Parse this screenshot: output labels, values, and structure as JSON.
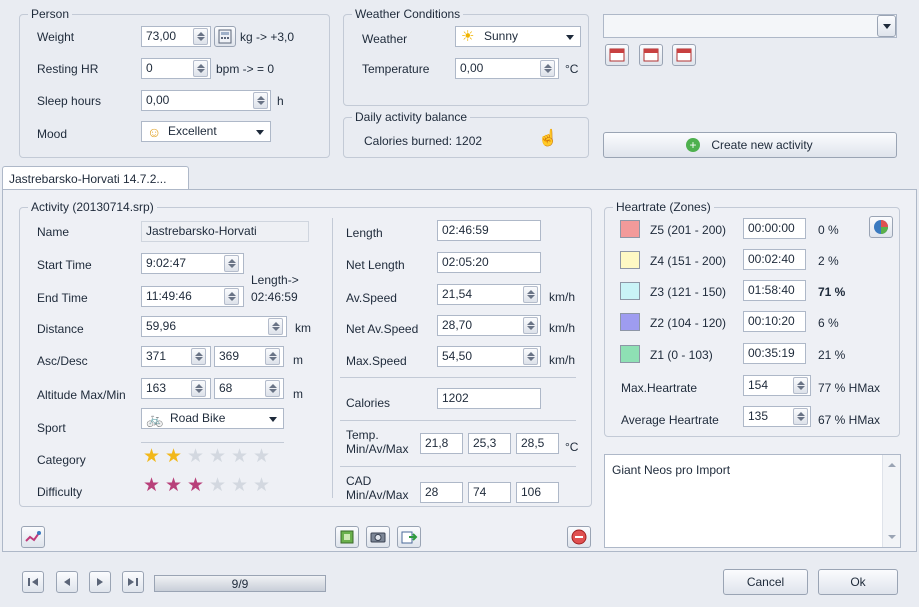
{
  "person": {
    "legend": "Person",
    "weight_label": "Weight",
    "weight_value": "73,00",
    "weight_unit": "kg  -> +3,0",
    "rhr_label": "Resting HR",
    "rhr_value": "0",
    "rhr_unit": "bpm  -> = 0",
    "sleep_label": "Sleep hours",
    "sleep_value": "0,00",
    "sleep_unit": "h",
    "mood_label": "Mood",
    "mood_value": "Excellent"
  },
  "weather": {
    "legend": "Weather Conditions",
    "weather_label": "Weather",
    "weather_value": "Sunny",
    "temp_label": "Temperature",
    "temp_value": "0,00",
    "temp_unit": "°C"
  },
  "balance": {
    "legend": "Daily activity balance",
    "text": "Calories burned: 1202"
  },
  "top_right": {
    "create_label": "Create new activity"
  },
  "tab": {
    "label": "Jastrebarsko-Horvati 14.7.2..."
  },
  "activity": {
    "legend": "Activity (20130714.srp)",
    "name_label": "Name",
    "name_value": "Jastrebarsko-Horvati",
    "start_label": "Start Time",
    "start_value": "9:02:47",
    "end_label": "End Time",
    "end_value": "11:49:46",
    "length_hint_1": "Length->",
    "length_hint_2": "02:46:59",
    "distance_label": "Distance",
    "distance_value": "59,96",
    "distance_unit": "km",
    "ascdesc_label": "Asc/Desc",
    "asc_value": "371",
    "desc_value": "369",
    "ascdesc_unit": "m",
    "alt_label": "Altitude Max/Min",
    "alt_max": "163",
    "alt_min": "68",
    "alt_unit": "m",
    "sport_label": "Sport",
    "sport_value": "Road Bike",
    "category_label": "Category",
    "category_stars": 2,
    "difficulty_label": "Difficulty",
    "difficulty_stars": 3,
    "length_label": "Length",
    "length_value": "02:46:59",
    "netlength_label": "Net Length",
    "netlength_value": "02:05:20",
    "avspeed_label": "Av.Speed",
    "avspeed_value": "21,54",
    "avspeed_unit": "km/h",
    "netavspeed_label": "Net Av.Speed",
    "netavspeed_value": "28,70",
    "netavspeed_unit": "km/h",
    "maxspeed_label": "Max.Speed",
    "maxspeed_value": "54,50",
    "maxspeed_unit": "km/h",
    "calories_label": "Calories",
    "calories_value": "1202",
    "temp_label_1": "Temp.",
    "temp_label_2": "Min/Av/Max",
    "temp_min": "21,8",
    "temp_av": "25,3",
    "temp_max": "28,5",
    "temp_unit": "°C",
    "cad_label_1": "CAD",
    "cad_label_2": "Min/Av/Max",
    "cad_min": "28",
    "cad_av": "74",
    "cad_max": "106"
  },
  "heartrate": {
    "legend": "Heartrate (Zones)",
    "zones": [
      {
        "label": "Z5 (201 - 200)",
        "time": "00:00:00",
        "pct": "0 %",
        "color": "#f29a9a"
      },
      {
        "label": "Z4 (151 - 200)",
        "time": "00:02:40",
        "pct": "2 %",
        "color": "#fdf8c4"
      },
      {
        "label": "Z3 (121 - 150)",
        "time": "01:58:40",
        "pct": "71 %",
        "color": "#c9f3f7"
      },
      {
        "label": "Z2 (104 - 120)",
        "time": "00:10:20",
        "pct": "6 %",
        "color": "#9e9cf0"
      },
      {
        "label": "Z1 (0 - 103)",
        "time": "00:35:19",
        "pct": "21 %",
        "color": "#8ee0b4"
      }
    ],
    "max_label": "Max.Heartrate",
    "max_value": "154",
    "max_pct": "77 % HMax",
    "avg_label": "Average Heartrate",
    "avg_value": "135",
    "avg_pct": "67 % HMax"
  },
  "notes": {
    "text": "Giant Neos pro Import"
  },
  "bottom": {
    "counter": "9/9",
    "progress": 1.0,
    "cancel": "Cancel",
    "ok": "Ok"
  }
}
